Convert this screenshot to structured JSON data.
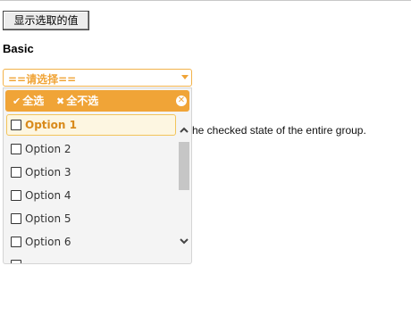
{
  "toolbar": {
    "show_selected_label": "显示选取的值"
  },
  "section": {
    "title": "Basic"
  },
  "background_text": "he checked state of the entire group.",
  "combo": {
    "placeholder": "==请选择==",
    "accent_color": "#f0a437",
    "header": {
      "select_all": "全选",
      "select_none": "全不选"
    },
    "options": [
      {
        "label": "Option 1",
        "highlighted": true
      },
      {
        "label": "Option 2"
      },
      {
        "label": "Option 3"
      },
      {
        "label": "Option 4"
      },
      {
        "label": "Option 5"
      },
      {
        "label": "Option 6"
      }
    ]
  }
}
